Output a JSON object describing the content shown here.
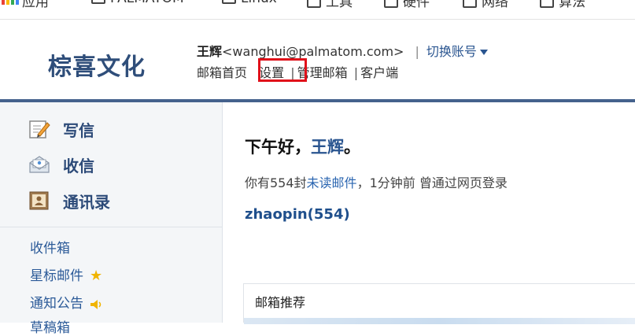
{
  "bookmarks": [
    {
      "label": "应用"
    },
    {
      "label": "PALMATOM"
    },
    {
      "label": "Linux"
    },
    {
      "label": "工具"
    },
    {
      "label": "硬件"
    },
    {
      "label": "网络"
    },
    {
      "label": "算法"
    }
  ],
  "header": {
    "brand": "棕喜文化",
    "user_name": "王辉",
    "user_email": "<wanghui@palmatom.com>",
    "separator": "|",
    "switch_account": "切换账号",
    "nav": {
      "home": "邮箱首页",
      "settings": "设置",
      "manage": "管理邮箱",
      "client": "客户端",
      "divider": "|"
    }
  },
  "sidebar": {
    "actions": [
      {
        "label": "写信",
        "icon": "pencil-note-icon"
      },
      {
        "label": "收信",
        "icon": "envelope-open-icon"
      },
      {
        "label": "通讯录",
        "icon": "address-book-icon"
      }
    ],
    "folders": [
      {
        "label": "收件箱"
      },
      {
        "label": "星标邮件",
        "icon": "star-icon"
      },
      {
        "label": "通知公告",
        "icon": "speaker-icon"
      },
      {
        "label": "草稿箱"
      }
    ]
  },
  "main": {
    "greeting_prefix": "下午好，",
    "greeting_name": "王辉",
    "greeting_suffix": "。",
    "info_prefix": "你有554封",
    "info_link": "未读邮件",
    "info_suffix": "，1分钟前 曾通过网页登录",
    "account_line": "zhaopin(554)",
    "recommend_title": "邮箱推荐"
  },
  "colors": {
    "brand": "#2f4e7a",
    "rule": "#45628d",
    "link": "#2a65b0",
    "highlight_box": "#e0101a"
  }
}
